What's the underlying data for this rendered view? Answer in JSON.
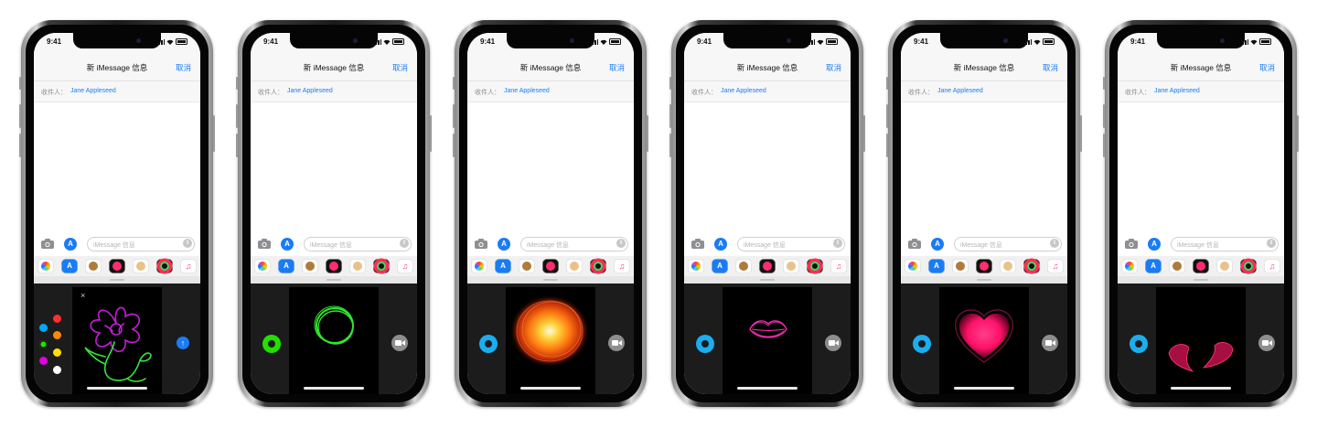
{
  "phones": [
    {
      "time": "9:41",
      "nav_title": "新 iMessage 信息",
      "cancel": "取消",
      "to_label": "收件人：",
      "to_name": "Jane Appleseed",
      "input_placeholder": "iMessage 信息",
      "effect": "sketch",
      "close_icon": "×",
      "send_icon": "↑"
    },
    {
      "time": "9:41",
      "nav_title": "新 iMessage 信息",
      "cancel": "取消",
      "to_label": "收件人：",
      "to_name": "Jane Appleseed",
      "input_placeholder": "iMessage 信息",
      "effect": "tap-ring",
      "record_color": "#22e000"
    },
    {
      "time": "9:41",
      "nav_title": "新 iMessage 信息",
      "cancel": "取消",
      "to_label": "收件人：",
      "to_name": "Jane Appleseed",
      "input_placeholder": "iMessage 信息",
      "effect": "fireball",
      "record_color": "#1aaeef"
    },
    {
      "time": "9:41",
      "nav_title": "新 iMessage 信息",
      "cancel": "取消",
      "to_label": "收件人：",
      "to_name": "Jane Appleseed",
      "input_placeholder": "iMessage 信息",
      "effect": "kiss",
      "record_color": "#1aaeef"
    },
    {
      "time": "9:41",
      "nav_title": "新 iMessage 信息",
      "cancel": "取消",
      "to_label": "收件人：",
      "to_name": "Jane Appleseed",
      "input_placeholder": "iMessage 信息",
      "effect": "heartbeat",
      "record_color": "#1aaeef"
    },
    {
      "time": "9:41",
      "nav_title": "新 iMessage 信息",
      "cancel": "取消",
      "to_label": "收件人：",
      "to_name": "Jane Appleseed",
      "input_placeholder": "iMessage 信息",
      "effect": "heartbreak",
      "record_color": "#1aaeef"
    }
  ],
  "palette_colors": [
    "#00a8ff",
    "#ff2d2d",
    "#ff8a00",
    "#22e000",
    "#ffe000",
    "#e000e0",
    "#ffffff"
  ],
  "app_icons": [
    "photos-icon",
    "app-store-icon",
    "animoji-icon",
    "digital-touch-icon",
    "memoji-icon",
    "activity-icon",
    "music-icon"
  ],
  "colors": {
    "accent": "#1a7cf5",
    "touch_bg": "#1c1c1c"
  }
}
